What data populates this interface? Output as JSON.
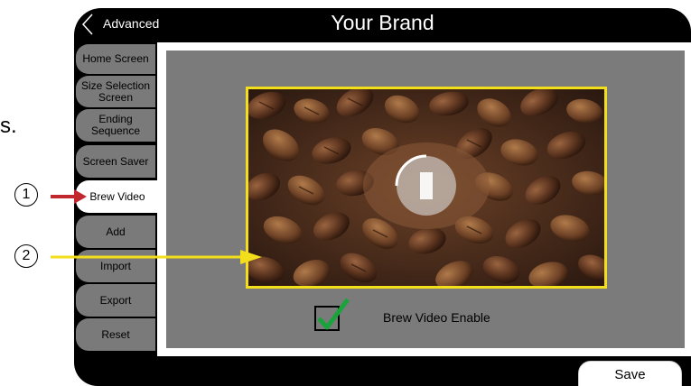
{
  "fragment_text": "s.",
  "header": {
    "back_label": "Advanced",
    "title": "Your Brand"
  },
  "sidebar": {
    "items": [
      {
        "label": "Home Screen"
      },
      {
        "label": "Size Selection Screen"
      },
      {
        "label": "Ending Sequence"
      },
      {
        "label": "Screen Saver"
      },
      {
        "label": "Brew Video",
        "active": true
      },
      {
        "label": "Add"
      },
      {
        "label": "Import"
      },
      {
        "label": "Export"
      },
      {
        "label": "Reset"
      }
    ]
  },
  "content": {
    "video": {
      "subject": "coffee beans",
      "overlay_icon": "loading-spinner-icon"
    },
    "enable_checkbox": {
      "label": "Brew Video Enable",
      "checked": true
    }
  },
  "footer": {
    "save_label": "Save"
  },
  "callouts": [
    {
      "number": "1"
    },
    {
      "number": "2"
    }
  ],
  "colors": {
    "accent_yellow": "#f2de1a",
    "annotation_red": "#c0282d",
    "check_green": "#1aa33b",
    "sidebar_gray": "#7a7a7a",
    "panel_gray": "#7b7b7b"
  }
}
